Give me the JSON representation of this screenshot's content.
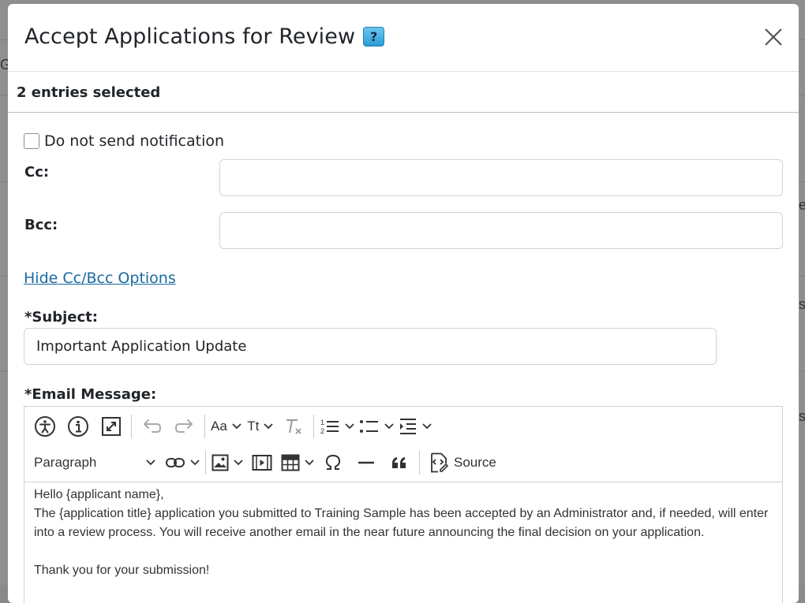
{
  "background": {
    "fragments": [
      "Gr",
      "e",
      "s",
      "s"
    ]
  },
  "modal": {
    "title": "Accept Applications for Review",
    "help_icon_glyph": "?",
    "selected_text": "2 entries selected",
    "do_not_send_label": "Do not send notification",
    "cc_label": "Cc:",
    "cc_value": "",
    "bcc_label": "Bcc:",
    "bcc_value": "",
    "hide_cc_bcc_link": "Hide Cc/Bcc Options",
    "subject_label": "*Subject:",
    "subject_value": "Important Application Update",
    "email_message_label": "*Email Message:"
  },
  "editor": {
    "toolbar": {
      "font_family_label": "Aa",
      "font_size_label": "Tt",
      "heading_select": "Paragraph",
      "source_label": "Source"
    },
    "content": {
      "line1": "Hello {applicant name},",
      "line2": "The {application title} application you submitted to Training Sample has been accepted by an Administrator and, if needed, will enter into a review process. You will receive another email in the near future announcing the final decision on your application.",
      "line3": "Thank you for your submission!"
    }
  },
  "colors": {
    "link": "#1a6aa0",
    "help_icon": "#2b9bd6",
    "overlay": "#8f8f8f"
  }
}
